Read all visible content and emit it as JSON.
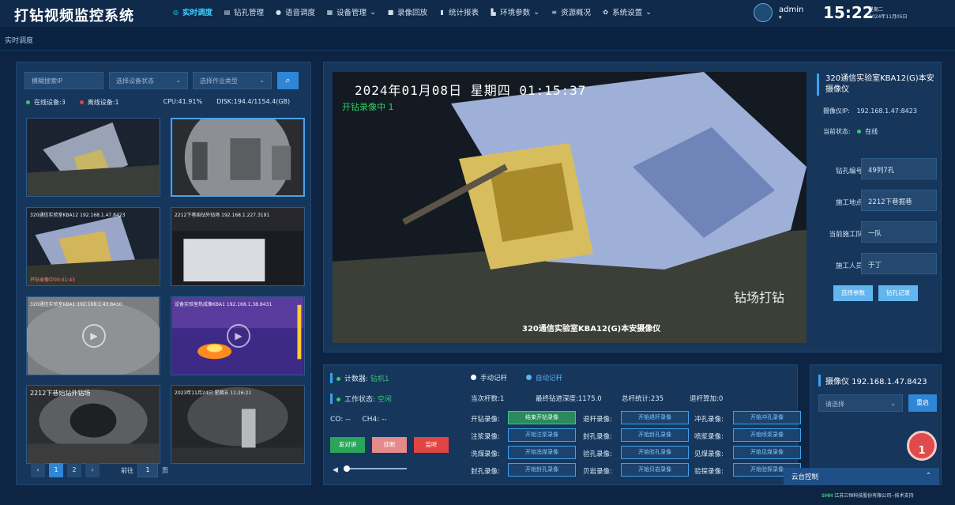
{
  "app": {
    "title": "打钻视频监控系统"
  },
  "nav": [
    {
      "label": "实时调度",
      "icon": "realtime-icon"
    },
    {
      "label": "钻孔管理",
      "icon": "list-icon"
    },
    {
      "label": "语音调度",
      "icon": "mic-icon"
    },
    {
      "label": "设备管理",
      "icon": "device-icon"
    },
    {
      "label": "录像回放",
      "icon": "video-icon"
    },
    {
      "label": "统计报表",
      "icon": "chart-icon"
    },
    {
      "label": "环境参数",
      "icon": "env-icon"
    },
    {
      "label": "资源概况",
      "icon": "resource-icon"
    },
    {
      "label": "系统设置",
      "icon": "gear-icon"
    }
  ],
  "user": {
    "name": "admin"
  },
  "clock": {
    "time": "15:22",
    "weekday": "星期二",
    "date": "2024年11月05日"
  },
  "breadcrumb": "实时调度",
  "filters": {
    "ip": "模糊搜索IP",
    "status": "选择设备状态",
    "worktype": "选择作业类型"
  },
  "stats": {
    "online": "在线设备:3",
    "offline": "离线设备:1",
    "cpu": "CPU:41.91%",
    "disk": "DISK:194.4/1154.4(GB)"
  },
  "thumbs": [
    {
      "caption": ""
    },
    {
      "caption": ""
    },
    {
      "caption": "320通信实验室KBA12  192.168.1.47.8423",
      "bottom": "开钻录像中00:01:43"
    },
    {
      "caption": "2212下巷始钻外钻场  192.168.1.227.3191",
      "bottom": ""
    },
    {
      "caption": "320通信实验室KBA1  192.168.1.43.8430",
      "bottom": ""
    },
    {
      "caption": "设备实验室热成像KBA1  192.168.1.38.8431",
      "bottom": ""
    },
    {
      "caption": "2212下巷始钻外钻场",
      "bottom": ""
    },
    {
      "caption": "2023年11月24日 星期五 11:26:21",
      "bottom": ""
    }
  ],
  "pager": {
    "pages": [
      "1",
      "2"
    ],
    "goto": "前往",
    "current": "1",
    "unit": "页"
  },
  "video": {
    "timestamp": "2024年01月08日  星期四  01:15:37",
    "status": "开钻录像中 1",
    "watermark": "钻场打钻",
    "caption": "320通信实验室KBA12(G)本安摄像仪"
  },
  "info": {
    "title": "320通信实验室KBA12(G)本安摄像仪",
    "ip_label": "摄像仪IP:",
    "ip": "192.168.1.47:8423",
    "state_label": "当前状态:",
    "state": "在线",
    "fields": [
      {
        "label": "钻孔编号",
        "value": "49列7孔"
      },
      {
        "label": "施工地点",
        "value": "2212下巷掘巷"
      },
      {
        "label": "当前施工队",
        "value": "一队"
      },
      {
        "label": "施工人员",
        "value": "于丁"
      }
    ],
    "btn_params": "选择参数",
    "btn_record": "钻孔记录"
  },
  "control": {
    "counter_label": "计数器:",
    "counter_value": "钻机1",
    "work_label": "工作状态:",
    "work_value": "空闲",
    "co": "CO: --",
    "ch4": "CH4: --",
    "btn_talk": "发对讲",
    "btn_hangup": "挂断",
    "btn_monitor": "监听",
    "mode_manual": "手动记杆",
    "mode_auto": "自动记杆",
    "cur_rods": "当次杆数:1",
    "final_depth": "最终钻进深度:1175.0",
    "total_rods": "总杆统计:235",
    "tool_rods": "退杆算加:0"
  },
  "recs": [
    {
      "label": "开钻录像:",
      "btn": "结束开钻录像",
      "on": true
    },
    {
      "label": "退杆录像:",
      "btn": "开始退杆录像"
    },
    {
      "label": "冲孔录像:",
      "btn": "开始冲孔录像"
    },
    {
      "label": "注浆录像:",
      "btn": "开始注浆录像"
    },
    {
      "label": "封孔录像:",
      "btn": "开始封孔录像"
    },
    {
      "label": "喷浆录像:",
      "btn": "开始喷浆录像"
    },
    {
      "label": "洗煤录像:",
      "btn": "开始洗煤录像"
    },
    {
      "label": "验孔录像:",
      "btn": "开始验孔录像"
    },
    {
      "label": "见煤录像:",
      "btn": "开始见煤录像"
    },
    {
      "label": "封孔录像:",
      "btn": "开始封孔录像"
    },
    {
      "label": "贝岩录像:",
      "btn": "开始贝岩录像"
    },
    {
      "label": "验探录像:",
      "btn": "开始验探录像"
    }
  ],
  "cam": {
    "title": "摄像仪 192.168.1.47.8423",
    "select": "请选择",
    "btn": "重启"
  },
  "ptz": "云台控制",
  "badge": "1",
  "footer": "江苏三恒科技股份有限公司--技术支持",
  "volume": 0.05
}
